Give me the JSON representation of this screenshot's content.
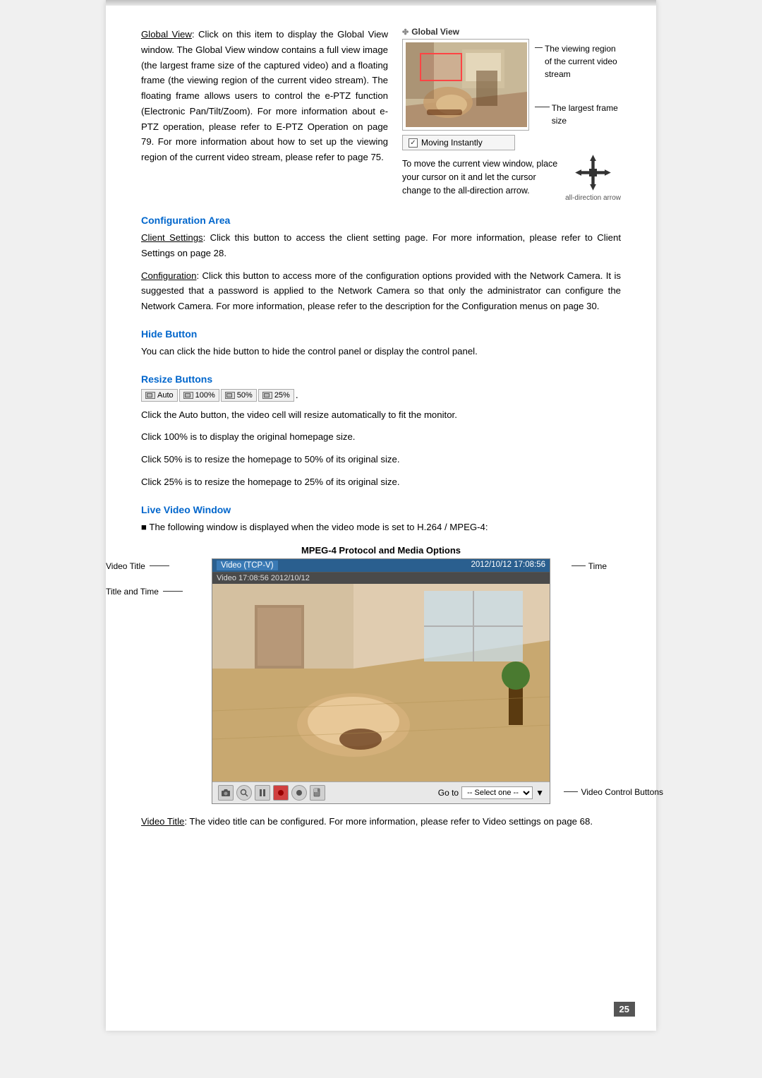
{
  "page": {
    "number": "25",
    "top_bar_color": "#c0c0c0"
  },
  "global_view": {
    "label": "Global View",
    "icon": "✤",
    "description": "Global View: Click on this item to display the Global View window. The Global View window contains a full view image (the largest frame size of the captured video) and a floating frame (the viewing region of the current video stream). The floating frame allows users to control the e-PTZ function (Electronic Pan/Tilt/Zoom). For more information about e-PTZ operation, please refer to E-PTZ Operation on page 79. For more information about how to set up the viewing region of the current video stream, please refer to page 75.",
    "annotation1": "The viewing region of the current video stream",
    "annotation2": "The largest frame size",
    "moving_instantly": "Moving Instantly",
    "move_description": "To move the current view window, place your cursor on it and let the cursor change to the all-direction arrow.",
    "all_direction_label": "all-direction arrow"
  },
  "configuration_area": {
    "heading": "Configuration Area",
    "client_settings_text": "Client Settings: Click this button to access the client setting page. For more information, please refer to Client Settings on page 28.",
    "configuration_text": "Configuration: Click this button to access more of the configuration options provided with the Network Camera. It is suggested that a password is applied to the Network Camera so that only the administrator can configure the Network Camera. For more information, please refer to the description for the Configuration menus on page 30."
  },
  "hide_button": {
    "heading": "Hide Button",
    "description": "You can click the hide button to hide the control panel or display the control panel."
  },
  "resize_buttons": {
    "heading": "Resize Buttons",
    "buttons": [
      "Auto",
      "100%",
      "50%",
      "25%"
    ],
    "descriptions": [
      "Click the Auto button, the video cell will resize automatically to fit the monitor.",
      "Click 100% is to display the original homepage size.",
      "Click 50% is to resize the homepage to 50% of its original size.",
      "Click 25% is to resize the homepage to 25% of its original size."
    ]
  },
  "live_video_window": {
    "heading": "Live Video Window",
    "bullet": "■",
    "description": "The following window is displayed when the video mode is set to H.264 / MPEG-4:",
    "mpeg4_label": "MPEG-4 Protocol and Media Options",
    "video_title": "Video (TCP-V)",
    "video_time": "2012/10/12 17:08:56",
    "video_subtitle": "Video 17:08:56  2012/10/12",
    "label_video_title": "Video Title",
    "label_title_time": "Title and Time",
    "label_time": "Time",
    "label_video_control": "Video Control Buttons",
    "goto_label": "Go to",
    "select_placeholder": "-- Select one --",
    "video_title_text": "Video Title: The video title can be configured. For more information, please refer to Video settings on page 68."
  }
}
